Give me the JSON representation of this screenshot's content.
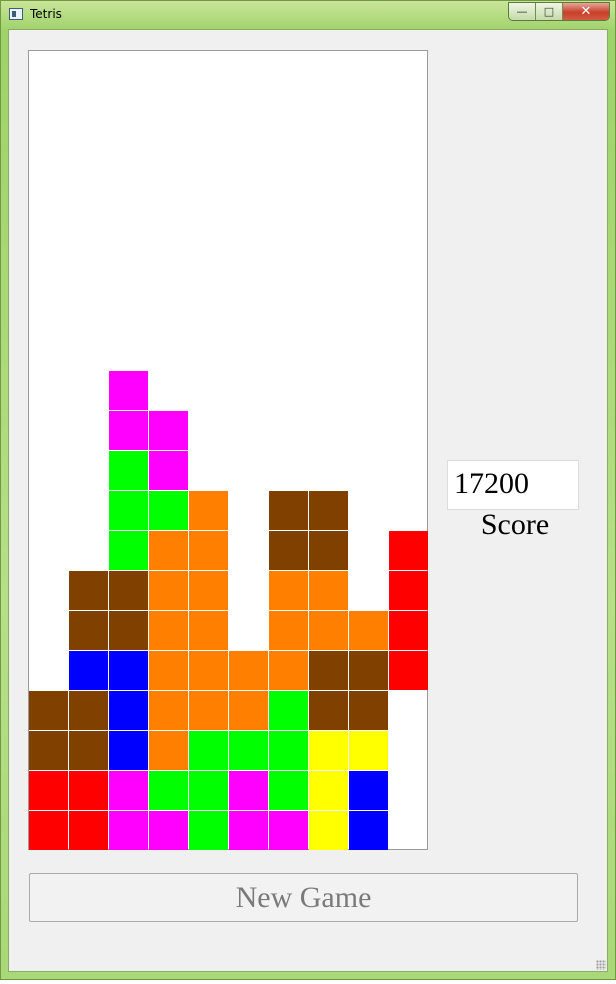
{
  "window": {
    "title": "Tetris",
    "minimize_glyph": "—",
    "maximize_glyph": "□",
    "close_glyph": "✕"
  },
  "game": {
    "columns": 10,
    "rows": 20,
    "colors": {
      "R": "#ff0000",
      "O": "#ff8000",
      "B": "#804000",
      "G": "#00ff00",
      "M": "#ff00ff",
      "Y": "#ffff00",
      "N": "#0000ff"
    },
    "cells": [
      "..........",
      "..........",
      "..........",
      "..........",
      "..........",
      "..........",
      "..........",
      "..........",
      "..M.......",
      "..MM......",
      "..GM......",
      "..GGO.BB..",
      "..GOO.BB.R",
      ".BBOO.OO.R",
      ".BBOO.OOOR",
      ".NNOOOOBBR",
      "BBNOOOGBB.",
      "BBNOGGGYY.",
      "RRMGGMGYN.",
      "RRMMGMMYN."
    ]
  },
  "score": {
    "value": "17200",
    "label": "Score"
  },
  "new_game_label": "New Game"
}
